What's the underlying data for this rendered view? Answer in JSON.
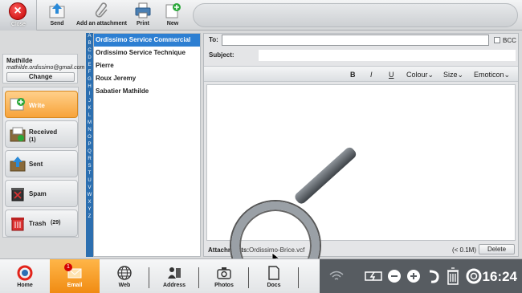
{
  "toolbar": {
    "close_label": "Close",
    "send_label": "Send",
    "attach_label": "Add an attachment",
    "print_label": "Print",
    "new_label": "New"
  },
  "user": {
    "name": "Mathilde",
    "email": "mathilde.ordissimo@gmail.com",
    "change_label": "Change"
  },
  "folders": [
    {
      "label": "Write",
      "count": ""
    },
    {
      "label": "Received",
      "count": "(1)"
    },
    {
      "label": "Sent",
      "count": ""
    },
    {
      "label": "Spam",
      "count": ""
    },
    {
      "label": "Trash",
      "count": "(29)"
    }
  ],
  "alphabet": [
    "A",
    "B",
    "C",
    "D",
    "E",
    "F",
    "G",
    "H",
    "I",
    "J",
    "K",
    "L",
    "M",
    "N",
    "O",
    "P",
    "Q",
    "R",
    "S",
    "T",
    "U",
    "V",
    "W",
    "X",
    "Y",
    "Z"
  ],
  "contacts": [
    "Ordissimo Service Commercial",
    "Ordissimo Service Technique",
    "Pierre",
    "Roux Jeremy",
    "Sabatier Mathilde"
  ],
  "compose": {
    "to_label": "To:",
    "to_value": "",
    "bcc_label": "BCC",
    "subject_label": "Subject:",
    "subject_value": "",
    "bold": "B",
    "italic": "I",
    "underline": "U",
    "colour": "Colour",
    "size": "Size",
    "emoticon": "Emoticon",
    "attachment_label": "Attachments:",
    "attachment_file": "Ordissimo-Brice.vcf",
    "attachment_size": "(< 0.1M)",
    "delete_label": "Delete"
  },
  "taskbar": {
    "home": "Home",
    "email": "Email",
    "email_badge": "1",
    "web": "Web",
    "address": "Address",
    "photos": "Photos",
    "docs": "Docs"
  },
  "status": {
    "time": "16:24"
  },
  "colors": {
    "accent": "#f39a2a",
    "selection": "#2d7fd2",
    "status_bar": "#575c61"
  }
}
